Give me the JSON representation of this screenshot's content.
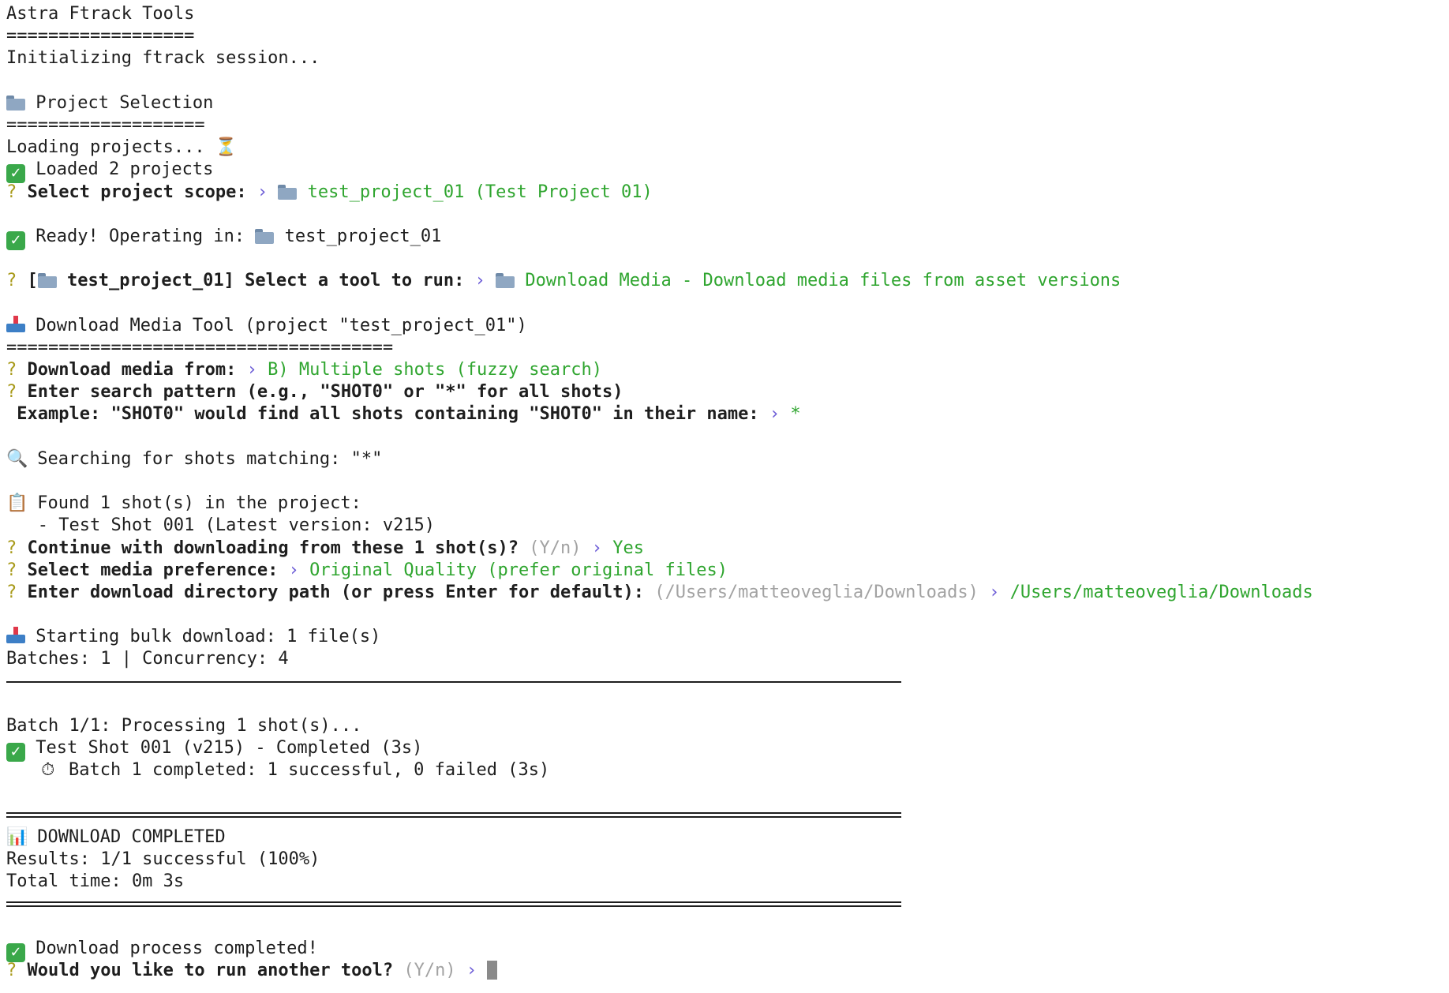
{
  "terminal": {
    "header": {
      "title": "Astra Ftrack Tools",
      "rule": "==================",
      "init": "Initializing ftrack session..."
    },
    "project_selection": {
      "heading": "Project Selection",
      "rule": "===================",
      "loading": "Loading projects...",
      "loaded": "Loaded 2 projects",
      "prompt": "Select project scope:",
      "answer": "test_project_01 (Test Project 01)"
    },
    "ready": {
      "label": "Ready! Operating in:",
      "project": "test_project_01"
    },
    "tool_select": {
      "prefix": "[",
      "project": "test_project_01]",
      "prompt": "Select a tool to run:",
      "answer": "Download Media - Download media files from asset versions"
    },
    "download_tool": {
      "heading": "Download Media Tool (project \"test_project_01\")",
      "rule": "=====================================",
      "source_prompt": "Download media from:",
      "source_answer": "B) Multiple shots (fuzzy search)",
      "pattern_prompt": "Enter search pattern (e.g., \"SHOT0\" or \"*\" for all shots)",
      "pattern_example": " Example: \"SHOT0\" would find all shots containing \"SHOT0\" in their name:",
      "pattern_answer": "*",
      "searching": "Searching for shots matching: \"*\"",
      "found": "Found 1 shot(s) in the project:",
      "found_item": "   - Test Shot 001 (Latest version: v215)",
      "continue_prompt": "Continue with downloading from these 1 shot(s)?",
      "continue_hint": "(Y/n)",
      "continue_answer": "Yes",
      "media_prompt": "Select media preference:",
      "media_answer": "Original Quality (prefer original files)",
      "dir_prompt": "Enter download directory path (or press Enter for default):",
      "dir_hint": "(/Users/matteoveglia/Downloads)",
      "dir_answer": "/Users/matteoveglia/Downloads"
    },
    "bulk": {
      "start": "Starting bulk download: 1 file(s)",
      "batches": "Batches: 1 | Concurrency: 4",
      "batch_line": "Batch 1/1: Processing 1 shot(s)...",
      "shot_result": "Test Shot 001 (v215) - Completed (3s)",
      "batch_done": "Batch 1 completed: 1 successful, 0 failed (3s)"
    },
    "summary": {
      "heading": "DOWNLOAD COMPLETED",
      "results": "Results: 1/1 successful (100%)",
      "time": "Total time: 0m 3s"
    },
    "final": {
      "done": "Download process completed!",
      "prompt": "Would you like to run another tool?",
      "hint": "(Y/n)"
    },
    "glyphs": {
      "question": "?",
      "arrow": "›",
      "bracket": "[",
      "hourglass": "⏳",
      "magnifier": "🔍",
      "clipboard": "📋",
      "stopwatch": "⏱",
      "chart": "📊"
    },
    "icons": [
      "folder-icon",
      "check-icon",
      "inbox-tray-icon",
      "hourglass-icon",
      "magnifier-icon",
      "clipboard-icon",
      "stopwatch-icon",
      "bar-chart-icon",
      "cursor-block"
    ],
    "colors": {
      "question": "#a89a1a",
      "answer": "#2fa52f",
      "hint": "#a2a2a2",
      "arrow": "#6a5ad6",
      "check": "#3aa84a"
    }
  }
}
